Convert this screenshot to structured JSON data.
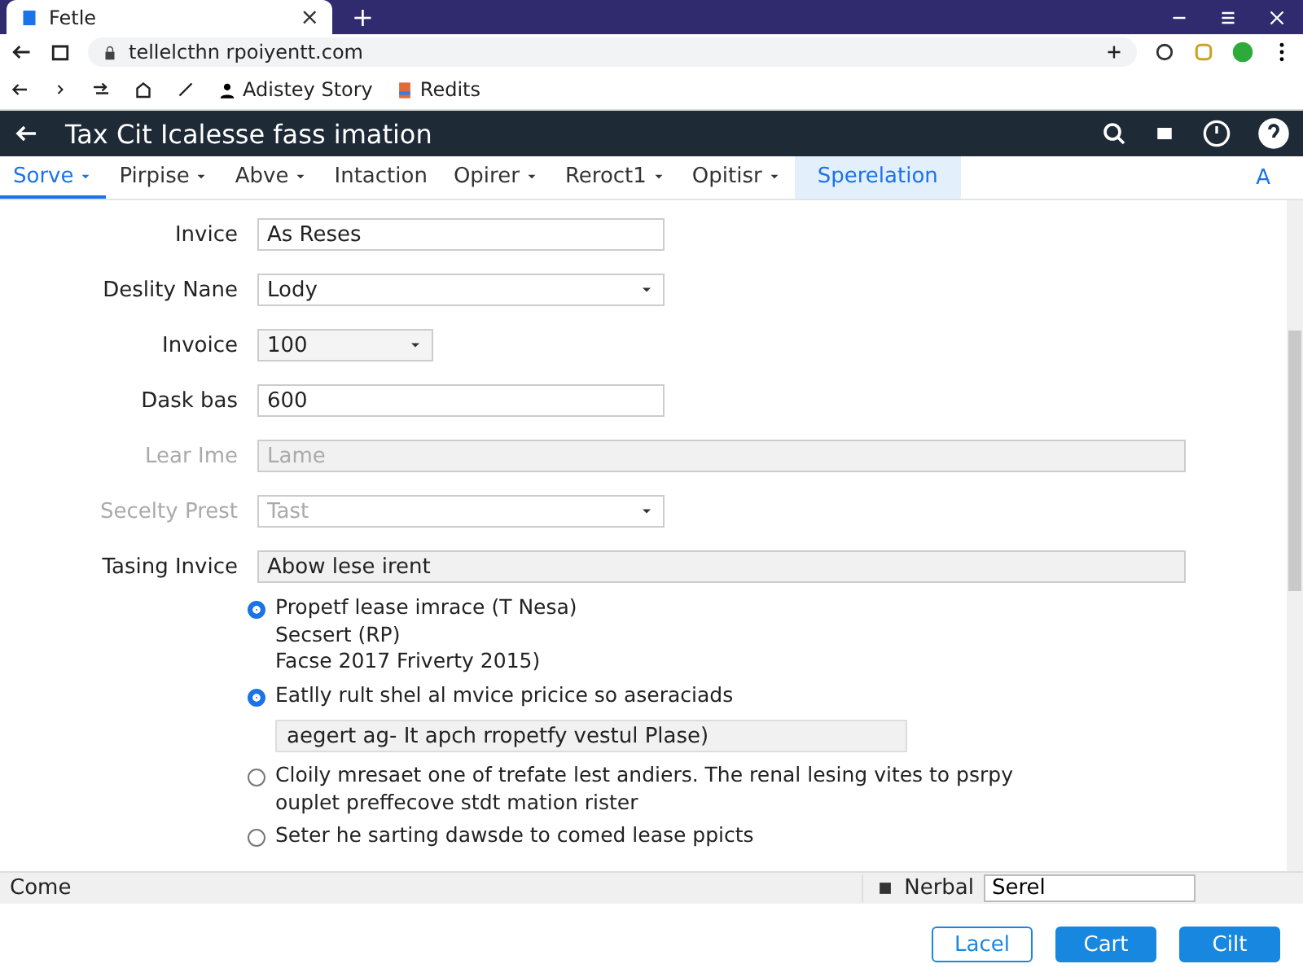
{
  "browser": {
    "tab": {
      "title": "Fetle",
      "close": "×"
    },
    "new_tab": "+",
    "address": "tellelcthn rpoiyentt.com",
    "bookmarks": [
      {
        "label": "Adistey Story",
        "kind": "person"
      },
      {
        "label": "Redits",
        "kind": "book"
      }
    ]
  },
  "app": {
    "title": "Tax Cit Icalesse fass imation",
    "menu": [
      {
        "label": "Sorve",
        "caret": true,
        "selected": true,
        "highlighted": false
      },
      {
        "label": "Pirpise",
        "caret": true,
        "selected": false,
        "highlighted": false
      },
      {
        "label": "Abve",
        "caret": true,
        "selected": false,
        "highlighted": false
      },
      {
        "label": "Intaction",
        "caret": false,
        "selected": false,
        "highlighted": false
      },
      {
        "label": "Opirer",
        "caret": true,
        "selected": false,
        "highlighted": false
      },
      {
        "label": "Reroct1",
        "caret": true,
        "selected": false,
        "highlighted": false
      },
      {
        "label": "Opitisr",
        "caret": true,
        "selected": false,
        "highlighted": false
      },
      {
        "label": "Sperelation",
        "caret": false,
        "selected": false,
        "highlighted": true
      }
    ],
    "menu_end": "A"
  },
  "form": {
    "rows": [
      {
        "label": "Invice",
        "value": "As Reses",
        "kind": "text",
        "disabled": false
      },
      {
        "label": "Deslity Nane",
        "value": "Lody",
        "kind": "select",
        "disabled": false
      },
      {
        "label": "Invoice",
        "value": "100",
        "kind": "short-select",
        "disabled": false
      },
      {
        "label": "Dask bas",
        "value": "600",
        "kind": "text",
        "disabled": false
      },
      {
        "label": "Lear Ime",
        "value": "Lame",
        "kind": "wide",
        "disabled": true
      },
      {
        "label": "Secelty Prest",
        "value": "Tast",
        "kind": "select",
        "disabled": true
      },
      {
        "label": "Tasing Invice",
        "value": "Abow lese irent",
        "kind": "shaded",
        "disabled": false
      }
    ],
    "options": [
      {
        "lines": [
          "Propetf lease imrace (T Nesa)",
          "Secsert (RP)",
          "Facse 2017 Friverty 2015)"
        ],
        "selected": true
      },
      {
        "lines": [
          "Eatlly rult shel al mvice pricice so aseraciads"
        ],
        "selected": true,
        "field": "aegert ag- It apch rropetfy vestul Plase)"
      },
      {
        "lines": [
          "Cloily mresaet one of trefate lest andiers. The renal lesing vites to psrpy",
          "ouplet preffecove stdt mation rister"
        ],
        "selected": false
      },
      {
        "lines": [
          "Seter he sarting dawsde to comed lease ppicts"
        ],
        "selected": false
      }
    ]
  },
  "status_bar": {
    "left": "Come",
    "label": "Nerbal",
    "value": "Serel"
  },
  "buttons": [
    {
      "label": "Lacel",
      "kind": "secondary"
    },
    {
      "label": "Cart",
      "kind": "primary"
    },
    {
      "label": "Cilt",
      "kind": "primary"
    }
  ]
}
